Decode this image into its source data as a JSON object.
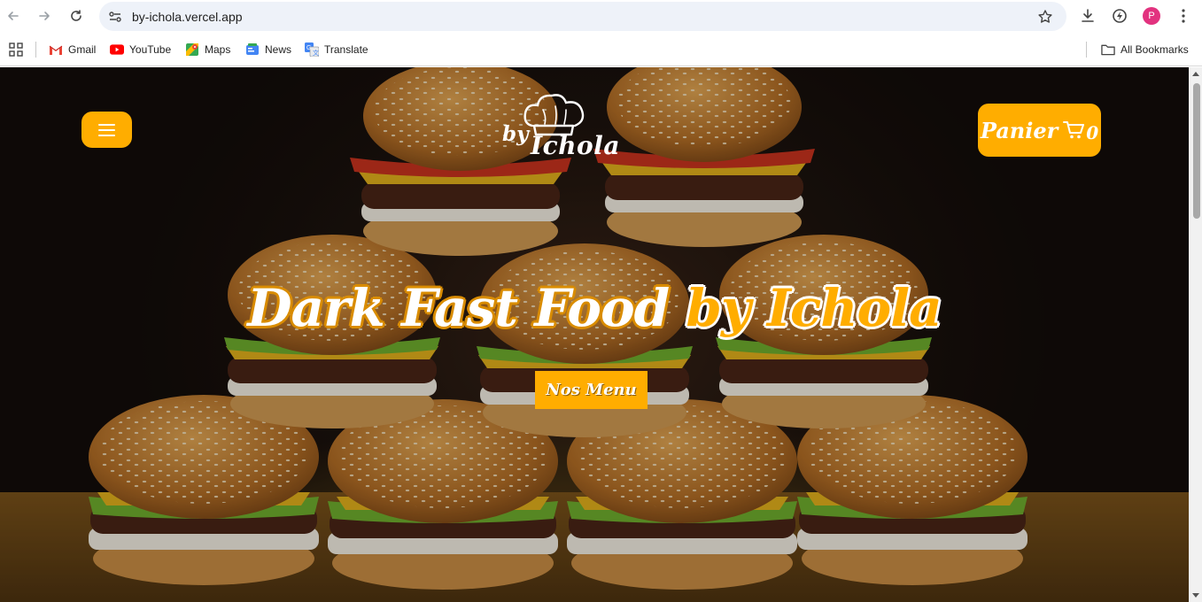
{
  "browser": {
    "url": "by-ichola.vercel.app",
    "avatar_letter": "P",
    "bookmarks": [
      {
        "label": "Gmail",
        "icon": "gmail-icon"
      },
      {
        "label": "YouTube",
        "icon": "youtube-icon"
      },
      {
        "label": "Maps",
        "icon": "maps-icon"
      },
      {
        "label": "News",
        "icon": "news-icon"
      },
      {
        "label": "Translate",
        "icon": "translate-icon"
      }
    ],
    "all_bookmarks_label": "All Bookmarks"
  },
  "page": {
    "logo": {
      "by": "by",
      "name": "Ichola"
    },
    "cart": {
      "label": "Panier",
      "count": "0"
    },
    "hero": {
      "title_part1": "Dark Fast Food ",
      "title_part2": "by Ichola"
    },
    "cta_label": "Nos Menu"
  },
  "colors": {
    "accent": "#ffad00",
    "accent_dark": "#d98c00",
    "text_light": "#ffffff"
  }
}
